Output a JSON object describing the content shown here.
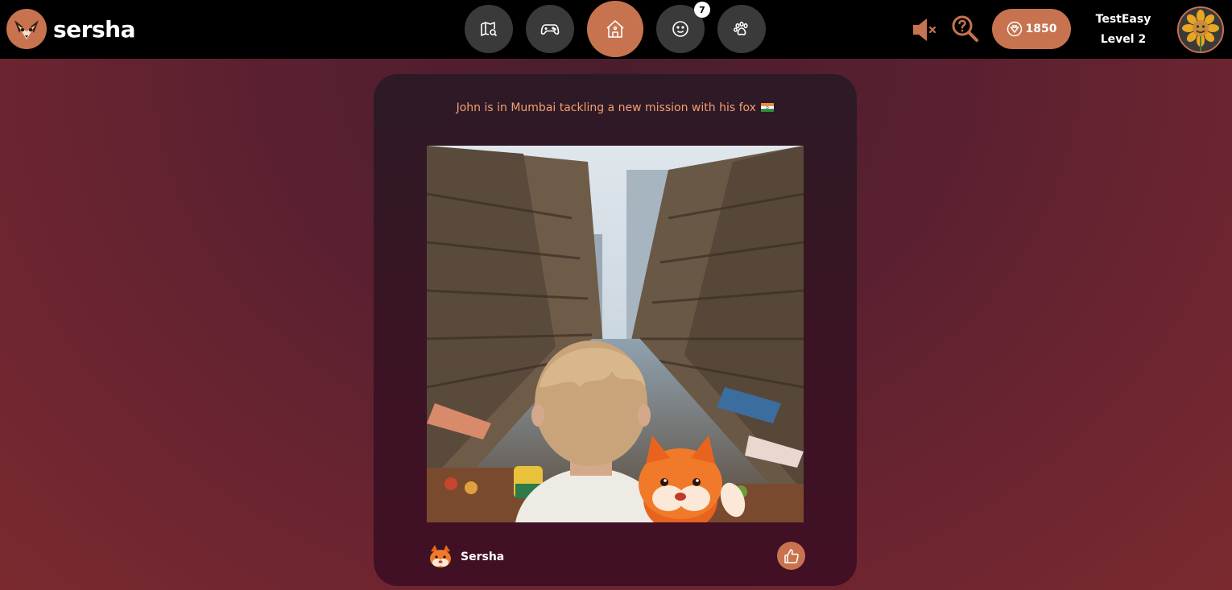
{
  "app": {
    "brand_name": "sersha",
    "accent_color": "#c8734f"
  },
  "nav": {
    "items": [
      {
        "name": "map-search",
        "icon": "map-search-icon",
        "active": false
      },
      {
        "name": "games",
        "icon": "gamepad-icon",
        "active": false
      },
      {
        "name": "home",
        "icon": "home-icon",
        "active": true
      },
      {
        "name": "chat",
        "icon": "smiley-icon",
        "active": false,
        "badge": "7"
      },
      {
        "name": "pets",
        "icon": "paw-icon",
        "active": false
      }
    ]
  },
  "header": {
    "sound_icon": "speaker-muted-icon",
    "help_icon": "help-search-icon",
    "coins": "1850",
    "coins_icon": "coin-icon",
    "username": "TestEasy",
    "level": "Level 2",
    "avatar_icon": "sunflower-avatar"
  },
  "post": {
    "caption": "John is in Mumbai tackling a new mission with his fox",
    "caption_flag": "india-flag-icon",
    "image_description_icon": "mumbai-street-illustration",
    "author": "Sersha",
    "author_avatar": "fox-avatar",
    "like_icon": "thumbs-up-icon"
  }
}
